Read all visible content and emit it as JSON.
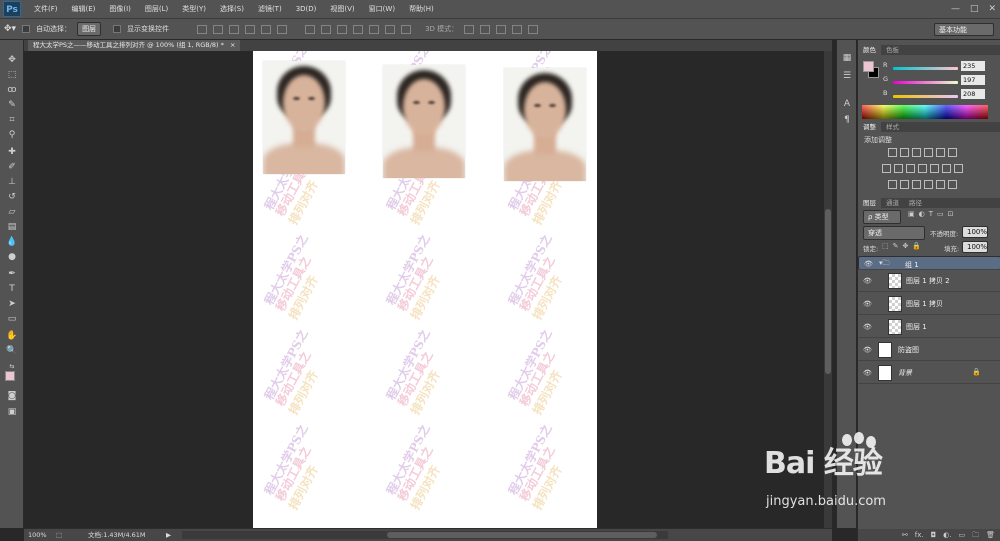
{
  "app": {
    "logo": "Ps"
  },
  "menu": [
    "文件(F)",
    "编辑(E)",
    "图像(I)",
    "图层(L)",
    "类型(Y)",
    "选择(S)",
    "滤镜(T)",
    "3D(D)",
    "视图(V)",
    "窗口(W)",
    "帮助(H)"
  ],
  "window_controls": [
    "—",
    "□",
    "✕"
  ],
  "options": {
    "auto_select_label": "自动选择：",
    "auto_select_value": "图层",
    "show_transform_label": "显示变换控件",
    "mode_3d_label": "3D 模式：",
    "workspace": "基本功能"
  },
  "document": {
    "tab_title": "程大太学PS之——移动工具之排列对齐 @ 100% (组 1, RGB/8) *",
    "close": "×",
    "watermark_lines": [
      "程大太学PS之",
      "移动工具之",
      "排列对齐"
    ]
  },
  "status": {
    "zoom": "100%",
    "doc_info": "文档:1.43M/4.61M",
    "arrow": "▶"
  },
  "color_panel": {
    "tabs": [
      "颜色",
      "色板"
    ],
    "r_label": "R",
    "r_value": "235",
    "g_label": "G",
    "g_value": "197",
    "b_label": "B",
    "b_value": "208",
    "fg_color": "#ebc5d0",
    "bg_color": "#000000"
  },
  "adjustments_panel": {
    "tabs": [
      "调整",
      "样式"
    ],
    "title": "添加调整"
  },
  "layers_panel": {
    "tabs": [
      "图层",
      "通道",
      "路径"
    ],
    "filter": "ρ 类型",
    "blend_mode": "穿透",
    "opacity_label": "不透明度:",
    "opacity_value": "100%",
    "lock_label": "锁定:",
    "fill_label": "填充:",
    "fill_value": "100%",
    "layers": [
      {
        "name": "组 1"
      },
      {
        "name": "图层 1 拷贝 2"
      },
      {
        "name": "图层 1 拷贝"
      },
      {
        "name": "图层 1"
      },
      {
        "name": "防盗图"
      },
      {
        "name": "背景"
      }
    ],
    "footer_icons": [
      "⚯",
      "fx.",
      "◘",
      "◐.",
      "▭",
      "🗀",
      "🗑"
    ]
  },
  "watermark": {
    "brand": "Bai 经验",
    "site": "jingyan.baidu.com"
  }
}
